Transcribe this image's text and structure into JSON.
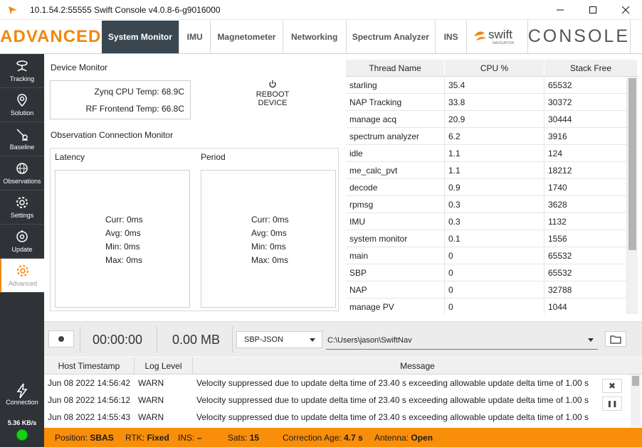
{
  "window": {
    "title": "10.1.54.2:55555 Swift Console v4.0.8-6-g9016000"
  },
  "nav": {
    "brand": "ADVANCED",
    "tabs": [
      {
        "label": "System Monitor",
        "active": true
      },
      {
        "label": "IMU",
        "active": false
      },
      {
        "label": "Magnetometer",
        "active": false
      },
      {
        "label": "Networking",
        "active": false
      },
      {
        "label": "Spectrum Analyzer",
        "active": false
      },
      {
        "label": "INS",
        "active": false
      }
    ],
    "logo_word": "swift",
    "logo_sub": "NAVIGATION",
    "console_word": "CONSOLE"
  },
  "sidebar": {
    "items": [
      {
        "label": "Tracking",
        "icon": "satellite-dish-icon"
      },
      {
        "label": "Solution",
        "icon": "location-pin-icon"
      },
      {
        "label": "Baseline",
        "icon": "baseline-icon"
      },
      {
        "label": "Observations",
        "icon": "globe-icon"
      },
      {
        "label": "Settings",
        "icon": "gear-icon"
      },
      {
        "label": "Update",
        "icon": "update-icon"
      },
      {
        "label": "Advanced",
        "icon": "advanced-gear-icon",
        "active": true
      }
    ],
    "connection_label": "Connection",
    "data_rate": "5.36 KB/s",
    "led_color": "#13d313"
  },
  "device_monitor": {
    "title": "Device Monitor",
    "zynq_temp": "Zynq CPU Temp: 68.9C",
    "rf_temp": "RF Frontend Temp: 66.8C",
    "reboot_label": "REBOOT DEVICE"
  },
  "obs_monitor": {
    "title": "Observation Connection Monitor",
    "latency": {
      "label": "Latency",
      "curr": "Curr: 0ms",
      "avg": "Avg: 0ms",
      "min": "Min: 0ms",
      "max": "Max: 0ms"
    },
    "period": {
      "label": "Period",
      "curr": "Curr: 0ms",
      "avg": "Avg: 0ms",
      "min": "Min: 0ms",
      "max": "Max: 0ms"
    }
  },
  "threads": {
    "headers": [
      "Thread Name",
      "CPU %",
      "Stack Free"
    ],
    "rows": [
      [
        "starling",
        "35.4",
        "65532"
      ],
      [
        "NAP Tracking",
        "33.8",
        "30372"
      ],
      [
        "manage acq",
        "20.9",
        "30444"
      ],
      [
        "spectrum analyzer",
        "6.2",
        "3916"
      ],
      [
        "idle",
        "1.1",
        "124"
      ],
      [
        "me_calc_pvt",
        "1.1",
        "18212"
      ],
      [
        "decode",
        "0.9",
        "1740"
      ],
      [
        "rpmsg",
        "0.3",
        "3628"
      ],
      [
        "IMU",
        "0.3",
        "1132"
      ],
      [
        "system monitor",
        "0.1",
        "1556"
      ],
      [
        "main",
        "0",
        "65532"
      ],
      [
        "SBP",
        "0",
        "65532"
      ],
      [
        "NAP",
        "0",
        "32788"
      ],
      [
        "manage PV",
        "0",
        "1044"
      ]
    ]
  },
  "logging": {
    "elapsed": "00:00:00",
    "size": "0.00 MB",
    "format": "SBP-JSON",
    "path": "C:\\Users\\jason\\SwiftNav"
  },
  "log": {
    "headers": [
      "Host Timestamp",
      "Log Level",
      "Message"
    ],
    "rows": [
      [
        "Jun 08 2022 14:56:42",
        "WARN",
        "Velocity suppressed due to update delta time of 23.40 s exceeding allowable update delta time of 1.00 s"
      ],
      [
        "Jun 08 2022 14:56:12",
        "WARN",
        "Velocity suppressed due to update delta time of 23.40 s exceeding allowable update delta time of 1.00 s"
      ],
      [
        "Jun 08 2022 14:55:43",
        "WARN",
        "Velocity suppressed due to update delta time of 23.40 s exceeding allowable update delta time of 1.00 s"
      ]
    ],
    "clear_glyph": "✖",
    "pause_glyph": "❚❚"
  },
  "status": {
    "position_label": "Position:",
    "position_value": "SBAS",
    "rtk_label": "RTK:",
    "rtk_value": "Fixed",
    "ins_label": "INS:",
    "ins_value": "–",
    "sats_label": "Sats:",
    "sats_value": "15",
    "corr_label": "Correction Age:",
    "corr_value": "4.7 s",
    "antenna_label": "Antenna:",
    "antenna_value": "Open"
  },
  "colors": {
    "accent": "#f2870f",
    "status_bar": "#f98e0a",
    "sidebar": "#2f3338",
    "active_tab": "#3a4750"
  }
}
